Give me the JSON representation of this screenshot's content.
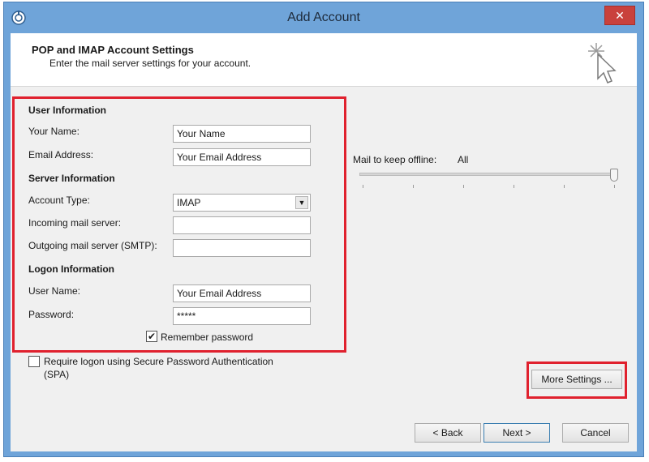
{
  "window": {
    "title": "Add Account",
    "close_glyph": "✕"
  },
  "header": {
    "title": "POP and IMAP Account Settings",
    "subtitle": "Enter the mail server settings for your account."
  },
  "user_info": {
    "heading": "User Information",
    "name_label": "Your Name:",
    "name_value": "Your Name",
    "email_label": "Email Address:",
    "email_value": "Your Email Address"
  },
  "server_info": {
    "heading": "Server Information",
    "account_type_label": "Account Type:",
    "account_type_value": "IMAP",
    "incoming_label": "Incoming mail server:",
    "incoming_value": "",
    "outgoing_label": "Outgoing mail server (SMTP):",
    "outgoing_value": ""
  },
  "logon_info": {
    "heading": "Logon Information",
    "username_label": "User Name:",
    "username_value": "Your Email Address",
    "password_label": "Password:",
    "password_value": "*****",
    "remember_label": "Remember password",
    "remember_checked": true
  },
  "spa": {
    "label_line1": "Require logon using Secure Password Authentication",
    "label_line2": "(SPA)",
    "checked": false
  },
  "offline": {
    "label": "Mail to keep offline:",
    "value": "All",
    "slider_fraction": 1.0
  },
  "buttons": {
    "more_settings": "More Settings ...",
    "back": "< Back",
    "next": "Next >",
    "cancel": "Cancel"
  },
  "colors": {
    "highlight": "#e0212e",
    "title_bar": "#6fa4d9",
    "close": "#c9413c"
  },
  "icons": {
    "app": "outlook-icon",
    "wizard": "cursor-sparkle-icon",
    "dropdown": "chevron-down-icon",
    "check": "checkmark-icon"
  }
}
